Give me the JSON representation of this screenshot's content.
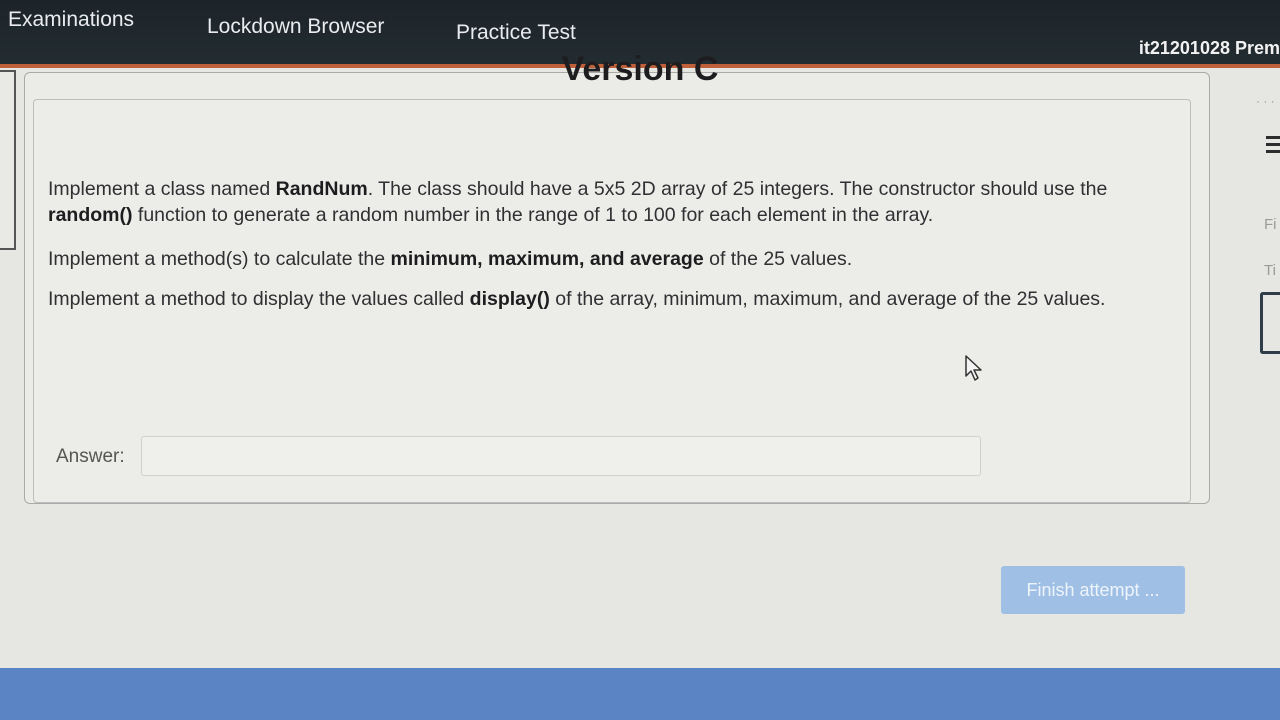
{
  "nav": {
    "items": [
      {
        "label": "Examinations"
      },
      {
        "label": "Lockdown Browser"
      },
      {
        "label": "Practice Test"
      }
    ],
    "user": "it21201028 Prem"
  },
  "question": {
    "title": "Version C",
    "p1": [
      "Implement a class named ",
      "RandNum",
      ". The class should have a 5x5 2D array of 25 integers. The constructor should use the ",
      "random()",
      " function to generate a random number in the range of 1 to 100 for each element in the array."
    ],
    "p2": [
      "Implement a method(s) to calculate the ",
      "minimum, maximum, and average",
      " of the 25 values."
    ],
    "p3": [
      "Implement a method to display the values called ",
      "display()",
      " of the array, minimum, maximum, and average of the 25 values."
    ],
    "answer_label": "Answer:",
    "answer_value": ""
  },
  "finish_button": "Finish attempt ...",
  "side": {
    "text1": "Fi",
    "text2": "Ti"
  },
  "icons": {
    "cursor": "mouse-pointer-icon",
    "menu": "hamburger-menu-icon"
  },
  "colors": {
    "topbar": "#1c2429",
    "accent_line": "#c0603a",
    "button": "#9fc0e4",
    "bottom_bar": "#5a84c4"
  }
}
